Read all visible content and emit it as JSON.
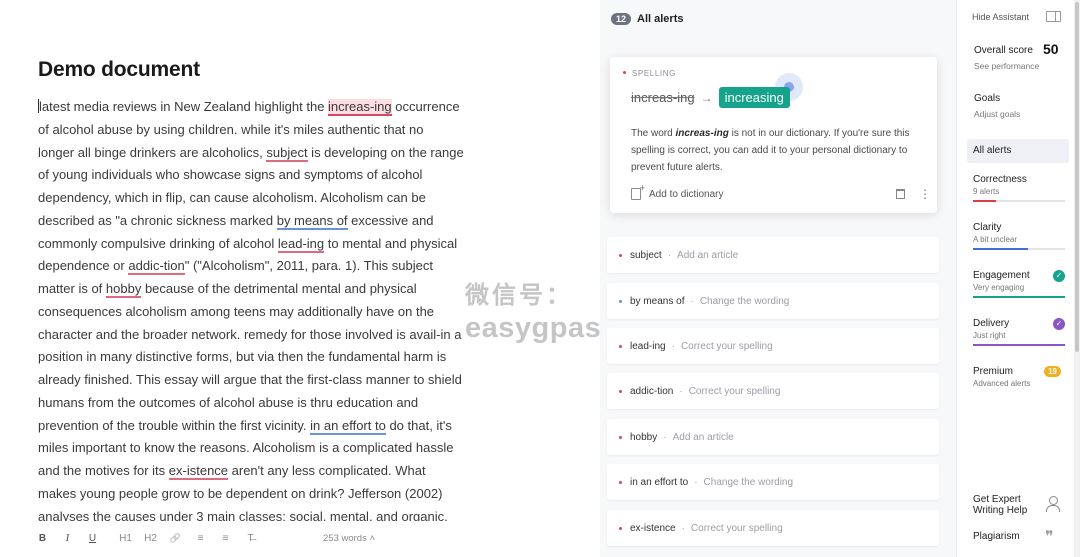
{
  "document": {
    "title": "Demo document",
    "lines": [
      [
        "",
        {
          "t": "latest media reviews in New Zealand highlight the "
        },
        {
          "t": "increas-ing",
          "u": "red-active"
        },
        {
          "t": " occurrence"
        }
      ],
      [
        "of alcohol abuse by using children. while it's miles authentic that no"
      ],
      [
        "longer all binge drinkers are alcoholics, ",
        {
          "t": "subject",
          "u": "red"
        },
        {
          "t": " is developing on the range"
        }
      ],
      [
        "of young individuals who showcase signs and symptoms of alcohol"
      ],
      [
        "dependency, which in flip, can cause alcoholism. Alcoholism can be"
      ],
      [
        "described as \"a chronic sickness marked ",
        {
          "t": "by means of",
          "u": "blue"
        },
        {
          "t": " excessive and"
        }
      ],
      [
        "commonly compulsive drinking of alcohol ",
        {
          "t": "lead-ing",
          "u": "red"
        },
        {
          "t": " to mental and physical"
        }
      ],
      [
        "dependence or ",
        {
          "t": "addic-tion",
          "u": "red"
        },
        {
          "t": "\" (\"Alcoholism\", 2011, para. 1). This subject"
        }
      ],
      [
        "matter is of ",
        {
          "t": "hobby",
          "u": "red"
        },
        {
          "t": " because of the detrimental mental and physical"
        }
      ],
      [
        "consequences alcoholism among teens may additionally have on the"
      ],
      [
        "character and the broader network. remedy for those involved is avail-in a"
      ],
      [
        "position in many distinctive forms, but via then the fundamental harm is"
      ],
      [
        "already finished. This essay will argue that the first-class manner to shield"
      ],
      [
        "humans from the outcomes of alcohol abuse is thru education and"
      ],
      [
        "prevention of the trouble within the first vicinity. ",
        {
          "t": "in an effort to",
          "u": "blue"
        },
        {
          "t": " do that, it's"
        }
      ],
      [
        "miles important to know the reasons. Alcoholism is a complicated hassle"
      ],
      [
        "and the motives for its ",
        {
          "t": "ex-istence",
          "u": "red"
        },
        {
          "t": " aren't any less complicated. What"
        }
      ],
      [
        "makes young people grow to be dependent on drink? Jefferson (2002)"
      ],
      [
        "analyses the causes under 3 main classes: social, mental, and organic."
      ]
    ]
  },
  "toolbar": {
    "bold": "B",
    "italic": "I",
    "underline": "U",
    "h1": "H1",
    "h2": "H2",
    "link": "🔗",
    "ol": "≡",
    "ul": "≡",
    "clear": "T̶",
    "word_count": "253 words",
    "word_count_caret": "˄"
  },
  "watermark": {
    "line1": "微信号：",
    "line2": "easygpaschool"
  },
  "alerts": {
    "count": "12",
    "title": "All alerts",
    "active_card": {
      "category": "SPELLING",
      "original": "increas-ing",
      "arrow": "→",
      "suggestion": "increasing",
      "desc_before": "The word ",
      "desc_word": "increas-ing",
      "desc_after": " is not in our dictionary. If you're sure this spelling is correct, you can add it to your personal dictionary to prevent future alerts.",
      "add_label": "Add to dictionary",
      "more": "⋮"
    },
    "list": [
      {
        "word": "subject",
        "hint": "Add an article",
        "color": "red"
      },
      {
        "word": "by means of",
        "hint": "Change the wording",
        "color": "blue"
      },
      {
        "word": "lead-ing",
        "hint": "Correct your spelling",
        "color": "red"
      },
      {
        "word": "addic-tion",
        "hint": "Correct your spelling",
        "color": "red"
      },
      {
        "word": "hobby",
        "hint": "Add an article",
        "color": "red"
      },
      {
        "word": "in an effort to",
        "hint": "Change the wording",
        "color": "red"
      },
      {
        "word": "ex-istence",
        "hint": "Correct your spelling",
        "color": "red"
      }
    ],
    "separator": "·"
  },
  "sidebar": {
    "hide_assistant": "Hide Assistant",
    "overall_score_label": "Overall score",
    "overall_score": "50",
    "see_performance": "See performance",
    "goals": "Goals",
    "adjust_goals": "Adjust goals",
    "all_alerts": "All alerts",
    "categories": [
      {
        "title": "Correctness",
        "sub": "9 alerts",
        "color": "#d6404e",
        "level": 0.25,
        "status": ""
      },
      {
        "title": "Clarity",
        "sub": "A bit unclear",
        "color": "#3f72d8",
        "level": 0.6,
        "status": ""
      },
      {
        "title": "Engagement",
        "sub": "Very engaging",
        "color": "#15a38b",
        "level": 1.0,
        "status": "check"
      },
      {
        "title": "Delivery",
        "sub": "Just right",
        "color": "#8b55c9",
        "level": 1.0,
        "status": "check"
      },
      {
        "title": "Premium",
        "sub": "Advanced alerts",
        "color": "#f2b01e",
        "level": 0,
        "status": "19"
      }
    ],
    "check_glyph": "✓",
    "expert_line1": "Get Expert",
    "expert_line2": "Writing Help",
    "plagiarism": "Plagiarism",
    "quote_glyph": "❞"
  }
}
